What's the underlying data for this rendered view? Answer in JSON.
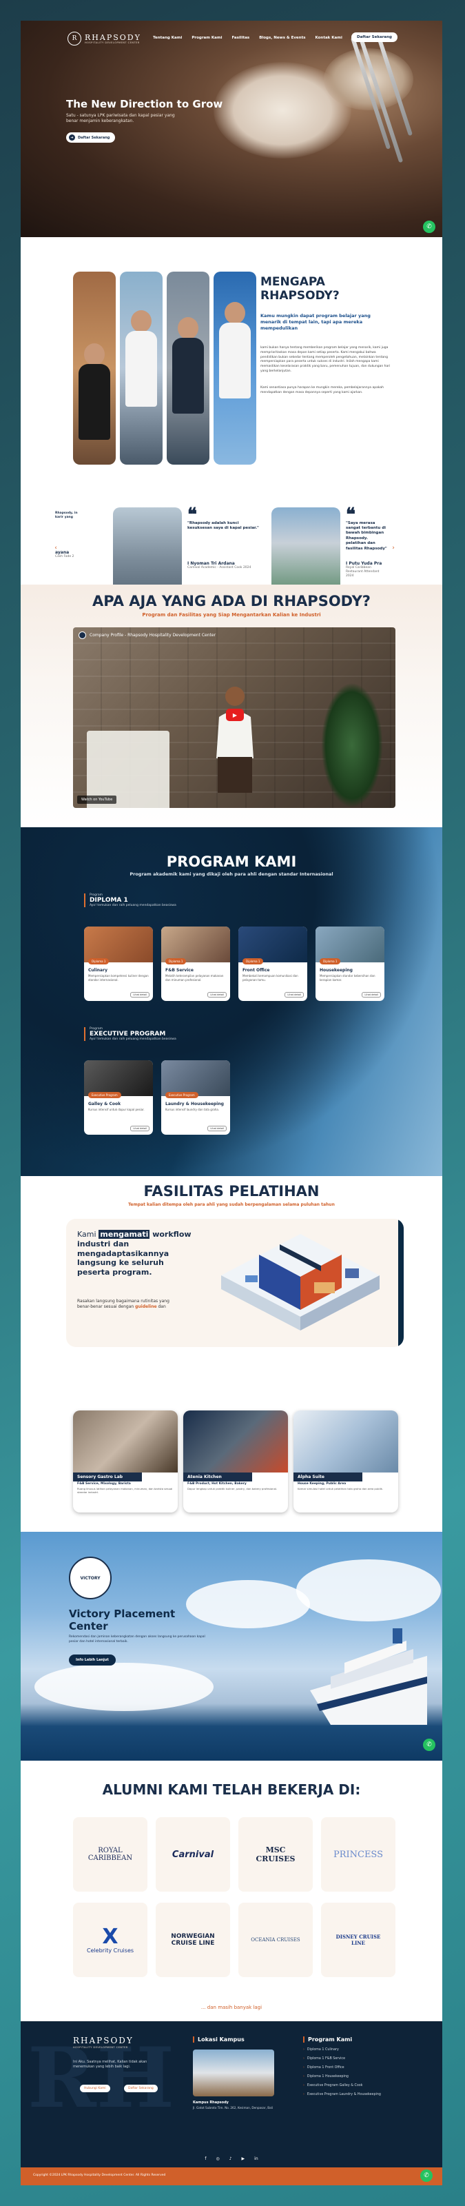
{
  "nav": {
    "logo_title": "RHAPSODY",
    "logo_sub": "HOSPITALITY DEVELOPMENT CENTER",
    "logo_mark": "R",
    "menu": [
      "Tentang Kami",
      "Program Kami",
      "Fasilitas",
      "Blogs, News & Events",
      "Kontak Kami"
    ],
    "cta": "Daftar Sekarang"
  },
  "hero": {
    "title": "The New Direction to Grow",
    "subtitle": "Satu - satunya LPK pariwisata dan kapal pesiar yang benar menjamin keberangkatan.",
    "cta": "Daftar Sekarang"
  },
  "why": {
    "title_line1": "MENGAPA",
    "title_line2": "RHAPSODY?",
    "lead": "Kamu mungkin dapat program belajar yang menarik di tempat lain, tapi apa mereka mempedulikan",
    "para1": "kami bukan hanya tentang memberikan program belajar yang menarik, kami juga memprioritaskan masa depan kami setiap peserta. Kami mengakui bahwa pendidikan bukan sekedar tentang memperoleh pengetahuan, melainkan tentang mempersiapkan para peserta untuk sukses di industri. Inilah mengapa kami memastikan keselarasan praktik yang baru, pemenuhan tujuan, dan dukungan hari yang berkelanjutan.",
    "para2": "Kami senantiasa punya harapan ke mungkin mereka, pembelajarannya apakah mendapatkan dengan masa depannya seperti yang kami ajarkan."
  },
  "testimonials": [
    {
      "quote": "\"Rhapsody adalah kunci kesuksesan saya di kapal pesiar.\"",
      "name": "I Nyoman Tri Ardana",
      "role": "Carnival Academic - Assistant Cook 2024"
    },
    {
      "quote": "\"Saya merasa sangat terbantu di bawah bimbingan Rhapsody. pelatihan dan fasilitas Rhapsody\"",
      "name": "I Putu Yuda Pra",
      "role": "Royal Caribbean Restaurant Attendant 2024"
    }
  ],
  "testimonial_partial": {
    "text": "Rhapsody, in karir yang",
    "name": "ayana",
    "role": "Cash Fade 2"
  },
  "what": {
    "title": "APA AJA YANG ADA DI RHAPSODY?",
    "subtitle": "Program dan Fasilitas yang Siap Mengantarkan Kalian ke Industri",
    "video_title": "Company Profile - Rhapsody Hospitality Development Center",
    "video_bar": "Watch on YouTube"
  },
  "program": {
    "title": "PROGRAM KAMI",
    "subtitle": "Program akademik kami yang dikaji oleh para ahli dengan standar Internasional",
    "groups": [
      {
        "small": "Program",
        "name": "DIPLOMA 1",
        "desc": "Ayo! temukan dan raih peluang mendapatkan beasiswa"
      },
      {
        "small": "Program",
        "name": "EXECUTIVE PROGRAM",
        "desc": "Ayo! temukan dan raih peluang mendapatkan beasiswa"
      }
    ],
    "diploma": [
      {
        "tag": "Diploma 1",
        "title": "Culinary",
        "desc": "Mempersiapkan kompetensi kuliner dengan standar internasional."
      },
      {
        "tag": "Diploma 1",
        "title": "F&B Service",
        "desc": "Melatih keterampilan pelayanan makanan dan minuman profesional."
      },
      {
        "tag": "Diploma 1",
        "title": "Front Office",
        "desc": "Membekali kemampuan komunikasi dan pelayanan tamu."
      },
      {
        "tag": "Diploma 1",
        "title": "Housekeeping",
        "desc": "Mempersiapkan standar kebersihan dan kerapian kamar."
      }
    ],
    "executive": [
      {
        "tag": "Executive Program",
        "title": "Galley & Cook",
        "desc": "Kursus intensif untuk dapur kapal pesiar."
      },
      {
        "tag": "Executive Program",
        "title": "Laundry & Housekeeping",
        "desc": "Kursus intensif laundry dan tata graha."
      }
    ],
    "learn": "Lihat detail"
  },
  "facility": {
    "title": "FASILITAS PELATIHAN",
    "subtitle": "Tempat kalian ditempa oleh para ahli yang sudah berpengalaman selama puluhan tahun",
    "hero_pre": "Kami",
    "hero_hl": "mengamati",
    "hero_rest": "workflow industri dan mengadaptasikannya langsung ke seluruh peserta program.",
    "para_pre": "Rasakan langsung bagaimana rutinitas yang benar-benar sesuai dengan",
    "para_hl": "guideline",
    "para_post": "dan",
    "cards": [
      {
        "label": "Sensory Gastro Lab",
        "sub": "F&B Service, Mixology, Barista",
        "desc": "Ruang khusus latihan pelayanan makanan, minuman, dan barista sesuai standar industri."
      },
      {
        "label": "Atenia Kitchen",
        "sub": "F&B Product, Hot Kitchen, Bakery",
        "desc": "Dapur lengkap untuk praktik kuliner, pastry, dan bakery profesional."
      },
      {
        "label": "Alpha Suite",
        "sub": "House Keeping, Public Area",
        "desc": "Kamar simulasi hotel untuk pelatihan tata graha dan area publik."
      }
    ]
  },
  "victory": {
    "title_line1": "Victory Placement",
    "title_line2": "Center",
    "desc": "Rekomendasi dan jaminan keberangkatan dengan akses langsung ke perusahaan kapal pesiar dan hotel internasional terbaik.",
    "cta": "Info Lebih Lanjut",
    "logo_text": "VICTORY"
  },
  "alumni": {
    "title": "ALUMNI KAMI TELAH BEKERJA DI:",
    "logos": [
      "ROYAL CARIBBEAN",
      "Carnival",
      "MSC CRUISES",
      "PRINCESS",
      "Celebrity Cruises",
      "NORWEGIAN CRUISE LINE",
      "OCEANIA CRUISES",
      "DISNEY CRUISE LINE"
    ],
    "more": "... dan masih banyak lagi"
  },
  "footer": {
    "bg_letter": "RH",
    "intro": "Ini Aku. Saatnya melihat, Kalian tidak akan menemukan yang lebih baik lagi.",
    "btn1": "Hubungi Kami",
    "btn2": "Daftar Sekarang",
    "campus_title": "Lokasi Kampus",
    "campus_name": "Kampus Rhapsody",
    "campus_addr": "Jl. Gatot Subroto Tim. No. 262, Kesiman, Denpasar, Bali",
    "program_title": "Program Kami",
    "programs": [
      "Diploma 1 Culinary",
      "Diploma 1 F&B Service",
      "Diploma 1 Front Office",
      "Diploma 1 Housekeeping",
      "Executive Program Galley & Cook",
      "Executive Program Laundry & Housekeeping"
    ],
    "copyright": "Copyright ©2024 LPK Rhapsody Hospitality Development Center. All Rights Reserved"
  },
  "colors": {
    "navy": "#1a2e4a",
    "accent": "#d0602a",
    "whatsapp": "#25c260"
  },
  "icons": {
    "whatsapp": "whatsapp-icon",
    "arrow_left": "arrow-left-icon",
    "arrow_right": "arrow-right-icon",
    "play": "play-icon"
  }
}
